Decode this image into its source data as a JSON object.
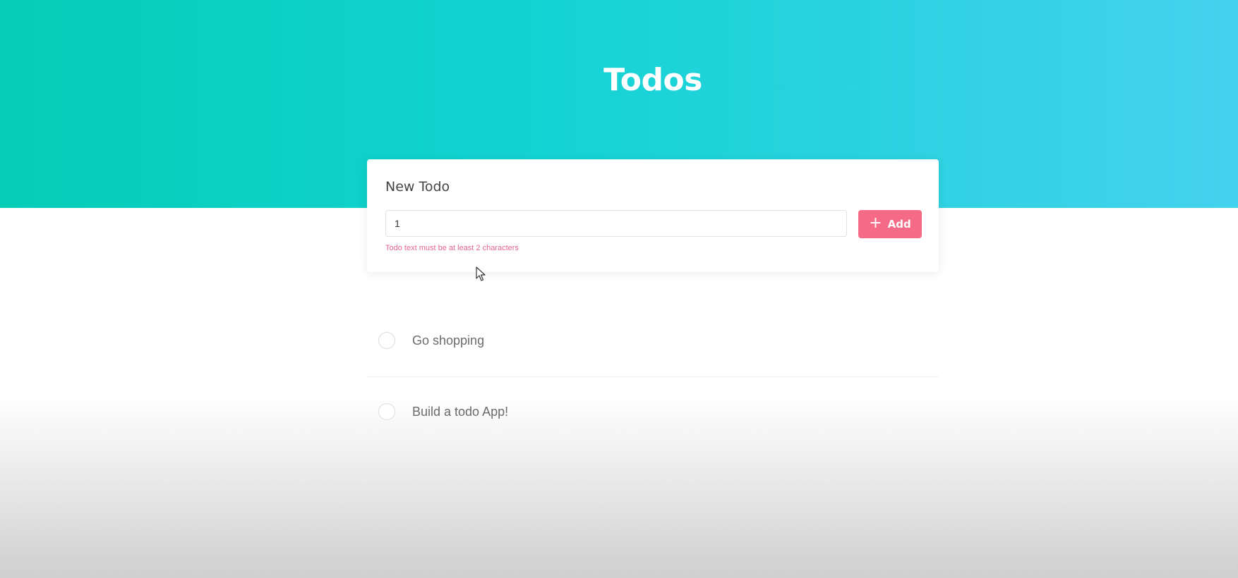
{
  "header": {
    "title": "Todos"
  },
  "new_todo": {
    "title": "New Todo",
    "input_value": "1",
    "add_label": "Add",
    "add_icon": "plus-icon",
    "error": "Todo text must be at least 2 characters",
    "colors": {
      "add_button": "#f56a86",
      "error_text": "#e8658a"
    }
  },
  "todos": [
    {
      "text": "Go shopping",
      "completed": false
    },
    {
      "text": "Build a todo App!",
      "completed": false
    }
  ],
  "colors": {
    "hero_start": "#05cdb6",
    "hero_end": "#45d2ee"
  }
}
